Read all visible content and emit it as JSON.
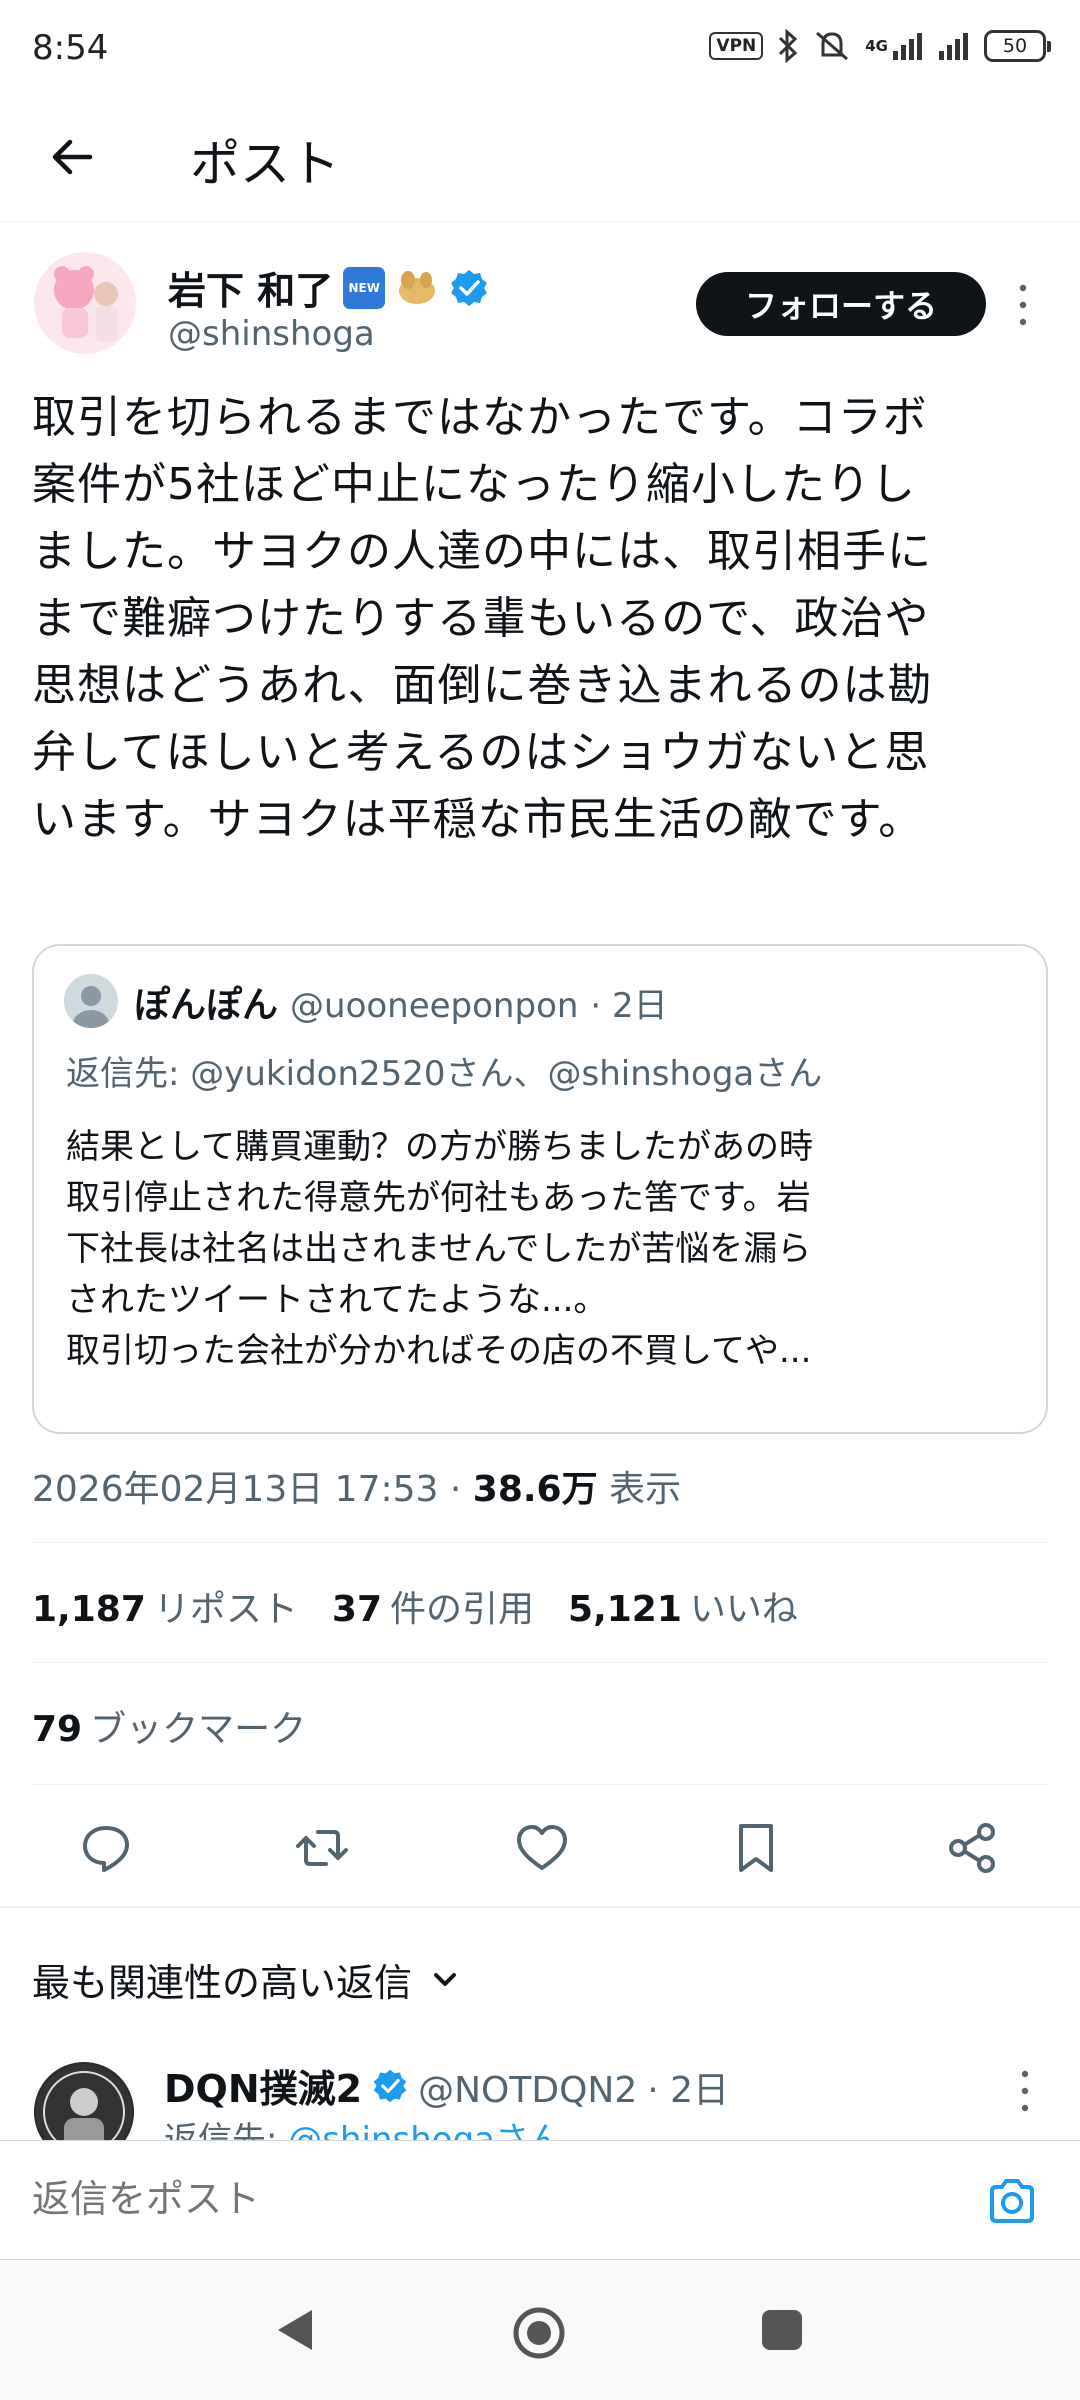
{
  "status_bar": {
    "time": "8:54",
    "vpn": "VPN",
    "network": "4G",
    "battery": "50"
  },
  "header": {
    "title": "ポスト"
  },
  "post": {
    "author_name": "岩下 和了",
    "author_handle": "@shinshoga",
    "new_badge": "NEW",
    "follow_label": "フォローする",
    "text": "取引を切られるまではなかったです。コラボ\n案件が5社ほど中止になったり縮小したりし\nました。サヨクの人達の中には、取引相手に\nまで難癖つけたりする輩もいるので、政治や\n思想はどうあれ、面倒に巻き込まれるのは勘\n弁してほしいと考えるのはショウガないと思\nいます。サヨクは平穏な市民生活の敵です。",
    "quote": {
      "name": "ぽんぽん",
      "handle": "@uooneeponpon",
      "time": "· 2日",
      "reply_to": "返信先: @yukidon2520さん、@shinshogaさん",
      "body": "結果として購買運動？の方が勝ちましたがあの時\n取引停止された得意先が何社もあった筈です。岩\n下社長は社名は出されませんでしたが苦悩を漏ら\nされたツイートされてたような...。\n取引切った会社が分かればその店の不買してや..."
    },
    "timestamp": "2026年02月13日 17:53",
    "views_value": "38.6万",
    "views_label": "表示",
    "stats": {
      "reposts_value": "1,187",
      "reposts_label": "リポスト",
      "quotes_value": "37",
      "quotes_label": "件の引用",
      "likes_value": "5,121",
      "likes_label": "いいね",
      "bookmarks_value": "79",
      "bookmarks_label": "ブックマーク"
    }
  },
  "replies": {
    "sort_label": "最も関連性の高い返信",
    "items": [
      {
        "name": "DQN撲滅2",
        "handle": "@NOTDQN2",
        "time": "· 2日",
        "reply_to_prefix": "返信先: ",
        "reply_to_link": "@shinshogaさん"
      }
    ]
  },
  "compose": {
    "placeholder": "返信をポスト"
  },
  "colors": {
    "accent": "#1d9bf0",
    "text": "#0f1419",
    "muted": "#536471"
  },
  "icons": [
    "back-arrow-icon",
    "verified-icon",
    "more-icon",
    "reply-icon",
    "repost-icon",
    "like-icon",
    "bookmark-icon",
    "share-icon",
    "chevron-down-icon",
    "camera-icon"
  ]
}
